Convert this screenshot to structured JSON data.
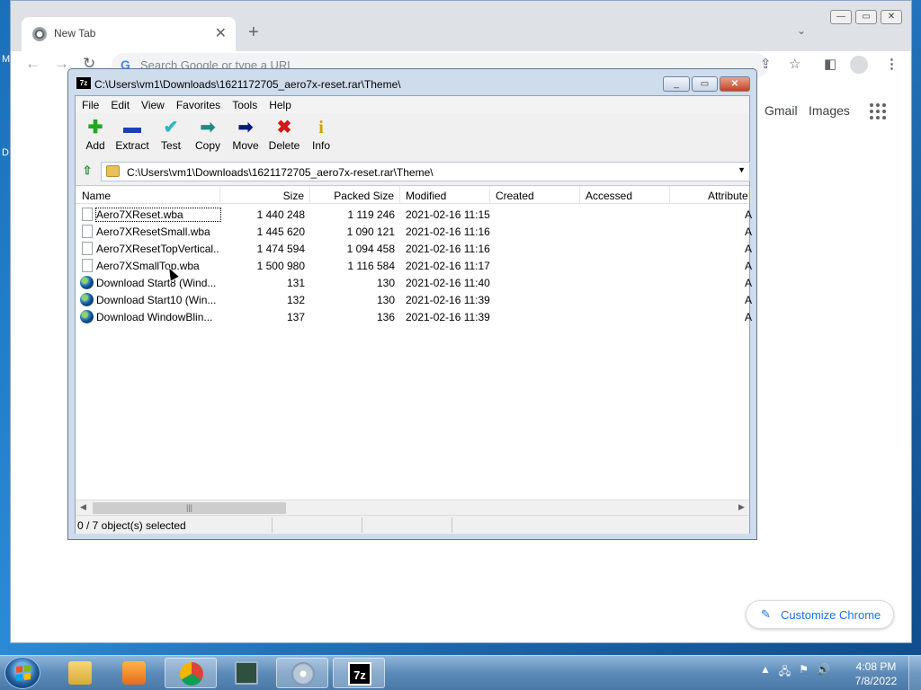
{
  "desktop": {
    "glyph1": "M",
    "glyph2": "D"
  },
  "chrome": {
    "tab_title": "New Tab",
    "tab_close": "✕",
    "new_tab": "+",
    "tab_search": "⌄",
    "omnibox_placeholder": "Search Google or type a URL",
    "g_letter": "G",
    "gmail": "Gmail",
    "images": "Images",
    "customize": "Customize Chrome",
    "win_min": "—",
    "win_max": "▭",
    "win_close": "✕"
  },
  "sevenzip": {
    "logo": "7z",
    "title": "C:\\Users\\vm1\\Downloads\\1621172705_aero7x-reset.rar\\Theme\\",
    "menu": [
      "File",
      "Edit",
      "View",
      "Favorites",
      "Tools",
      "Help"
    ],
    "toolbar": [
      {
        "label": "Add",
        "icon": "plus-icon",
        "color": "#22a822"
      },
      {
        "label": "Extract",
        "icon": "minus-icon",
        "color": "#1d3fb5"
      },
      {
        "label": "Test",
        "icon": "check-icon",
        "color": "#2bb9c4"
      },
      {
        "label": "Copy",
        "icon": "copy-arrow-icon",
        "color": "#1e8c7a"
      },
      {
        "label": "Move",
        "icon": "move-arrow-icon",
        "color": "#0b1a7a"
      },
      {
        "label": "Delete",
        "icon": "delete-x-icon",
        "color": "#d01818"
      },
      {
        "label": "Info",
        "icon": "info-icon",
        "color": "#c9a300"
      }
    ],
    "address": "C:\\Users\\vm1\\Downloads\\1621172705_aero7x-reset.rar\\Theme\\",
    "columns": [
      "Name",
      "Size",
      "Packed Size",
      "Modified",
      "Created",
      "Accessed",
      "Attribute"
    ],
    "rows": [
      {
        "name": "Aero7XReset.wba",
        "size": "1 440 248",
        "packed": "1 119 246",
        "modified": "2021-02-16 11:15",
        "attr": "A",
        "type": "file"
      },
      {
        "name": "Aero7XResetSmall.wba",
        "size": "1 445 620",
        "packed": "1 090 121",
        "modified": "2021-02-16 11:16",
        "attr": "A",
        "type": "file"
      },
      {
        "name": "Aero7XResetTopVertical...",
        "size": "1 474 594",
        "packed": "1 094 458",
        "modified": "2021-02-16 11:16",
        "attr": "A",
        "type": "file"
      },
      {
        "name": "Aero7XSmallTop.wba",
        "size": "1 500 980",
        "packed": "1 116 584",
        "modified": "2021-02-16 11:17",
        "attr": "A",
        "type": "file"
      },
      {
        "name": "Download Start8 (Wind...",
        "size": "131",
        "packed": "130",
        "modified": "2021-02-16 11:40",
        "attr": "A",
        "type": "web"
      },
      {
        "name": "Download Start10 (Win...",
        "size": "132",
        "packed": "130",
        "modified": "2021-02-16 11:39",
        "attr": "A",
        "type": "web"
      },
      {
        "name": "Download WindowBlin...",
        "size": "137",
        "packed": "136",
        "modified": "2021-02-16 11:39",
        "attr": "A",
        "type": "web"
      }
    ],
    "status": "0 / 7 object(s) selected"
  },
  "taskbar": {
    "apps": [
      "explorer-icon",
      "media-player-icon",
      "chrome-icon",
      "task-manager-icon",
      "disc-icon",
      "sevenzip-icon"
    ],
    "clock_time": "4:08 PM",
    "clock_date": "7/8/2022",
    "tray_arrow": "▲"
  }
}
